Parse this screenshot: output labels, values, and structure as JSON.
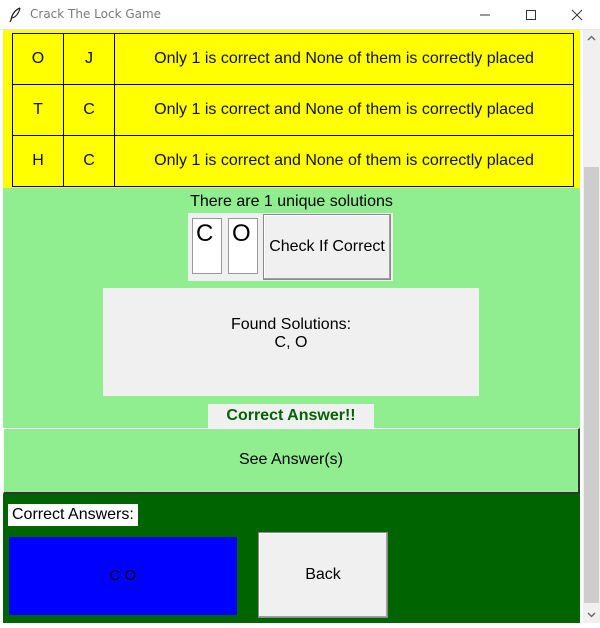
{
  "window": {
    "title": "Crack The Lock Game"
  },
  "clues": [
    {
      "letter1": "O",
      "letter2": "J",
      "hint": "Only 1 is correct and None of them is correctly placed"
    },
    {
      "letter1": "T",
      "letter2": "C",
      "hint": "Only 1 is correct and None of them is correctly placed"
    },
    {
      "letter1": "H",
      "letter2": "C",
      "hint": "Only 1 is correct and None of them is correctly placed"
    }
  ],
  "solver": {
    "unique_text": "There are 1 unique solutions",
    "entry1": "C",
    "entry2": "O",
    "check_label": "Check If Correct",
    "found_label": "Found Solutions:",
    "found_values": "C, O",
    "status": "Correct Answer!!",
    "see_answers_label": "See Answer(s)"
  },
  "answers": {
    "label": "Correct Answers:",
    "value": "C O",
    "back_label": "Back"
  },
  "colors": {
    "clue_bg": "#ffff00",
    "panel_bg": "#90ee90",
    "answers_bg": "#006400",
    "answer_box": "#0000ff",
    "status_text": "#006400"
  }
}
